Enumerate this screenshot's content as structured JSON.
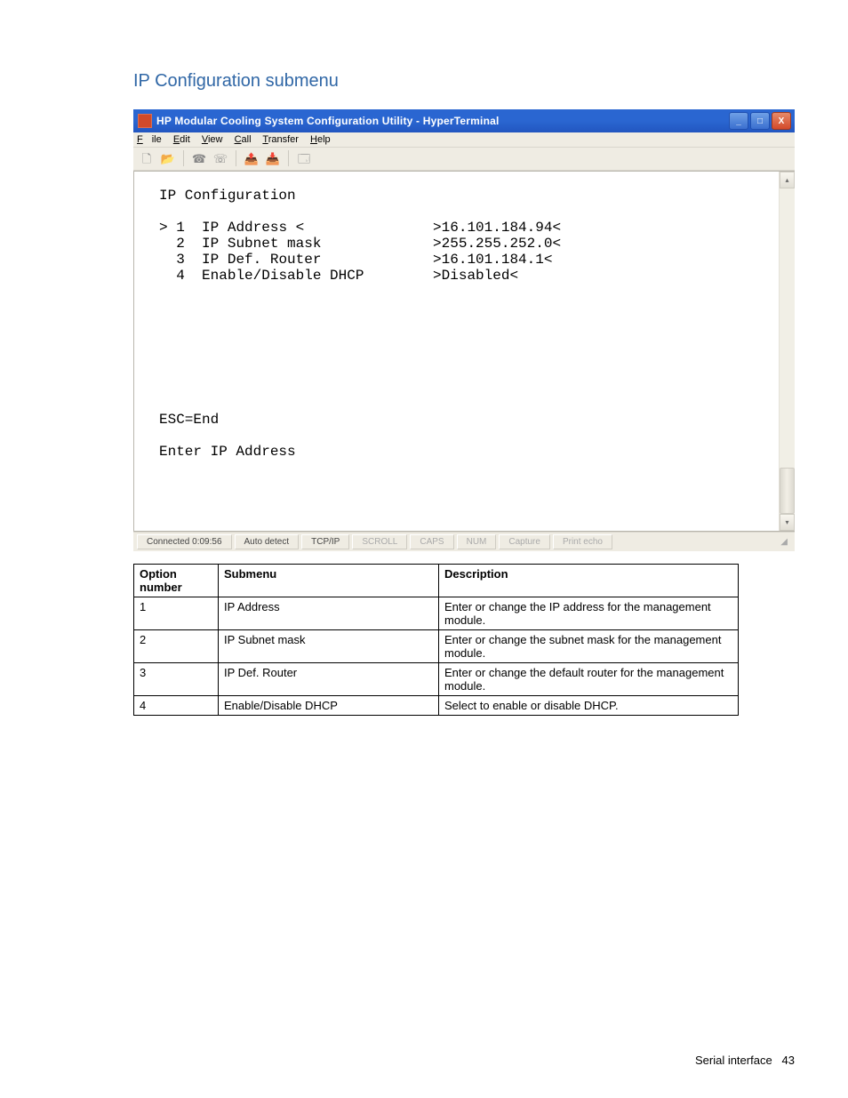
{
  "heading": "IP Configuration submenu",
  "window": {
    "title": "HP Modular Cooling System Configuration Utility - HyperTerminal",
    "menubar": {
      "file": "File",
      "edit": "Edit",
      "view": "View",
      "call": "Call",
      "transfer": "Transfer",
      "help": "Help"
    },
    "terminal": {
      "title": "IP Configuration",
      "rows": [
        {
          "marker": ">",
          "num": "1",
          "label": "IP Address <",
          "value": ">16.101.184.94<"
        },
        {
          "marker": " ",
          "num": "2",
          "label": "IP Subnet mask",
          "value": ">255.255.252.0<"
        },
        {
          "marker": " ",
          "num": "3",
          "label": "IP Def. Router",
          "value": ">16.101.184.1<"
        },
        {
          "marker": " ",
          "num": "4",
          "label": "Enable/Disable DHCP",
          "value": ">Disabled<"
        }
      ],
      "esc": "ESC=End",
      "prompt": "Enter IP Address"
    },
    "statusbar": {
      "connected": "Connected 0:09:56",
      "autodetect": "Auto detect",
      "protocol": "TCP/IP",
      "scroll": "SCROLL",
      "caps": "CAPS",
      "num": "NUM",
      "capture": "Capture",
      "printecho": "Print echo"
    }
  },
  "table": {
    "headers": {
      "opt": "Option number",
      "sub": "Submenu",
      "desc": "Description"
    },
    "rows": [
      {
        "opt": "1",
        "sub": "IP Address",
        "desc": "Enter or change the IP address for the management module."
      },
      {
        "opt": "2",
        "sub": "IP Subnet mask",
        "desc": "Enter or change the subnet mask for the management module."
      },
      {
        "opt": "3",
        "sub": "IP Def. Router",
        "desc": "Enter or change the default router for the management module."
      },
      {
        "opt": "4",
        "sub": "Enable/Disable DHCP",
        "desc": "Select to enable or disable DHCP."
      }
    ]
  },
  "footer": {
    "label": "Serial interface",
    "page": "43"
  }
}
